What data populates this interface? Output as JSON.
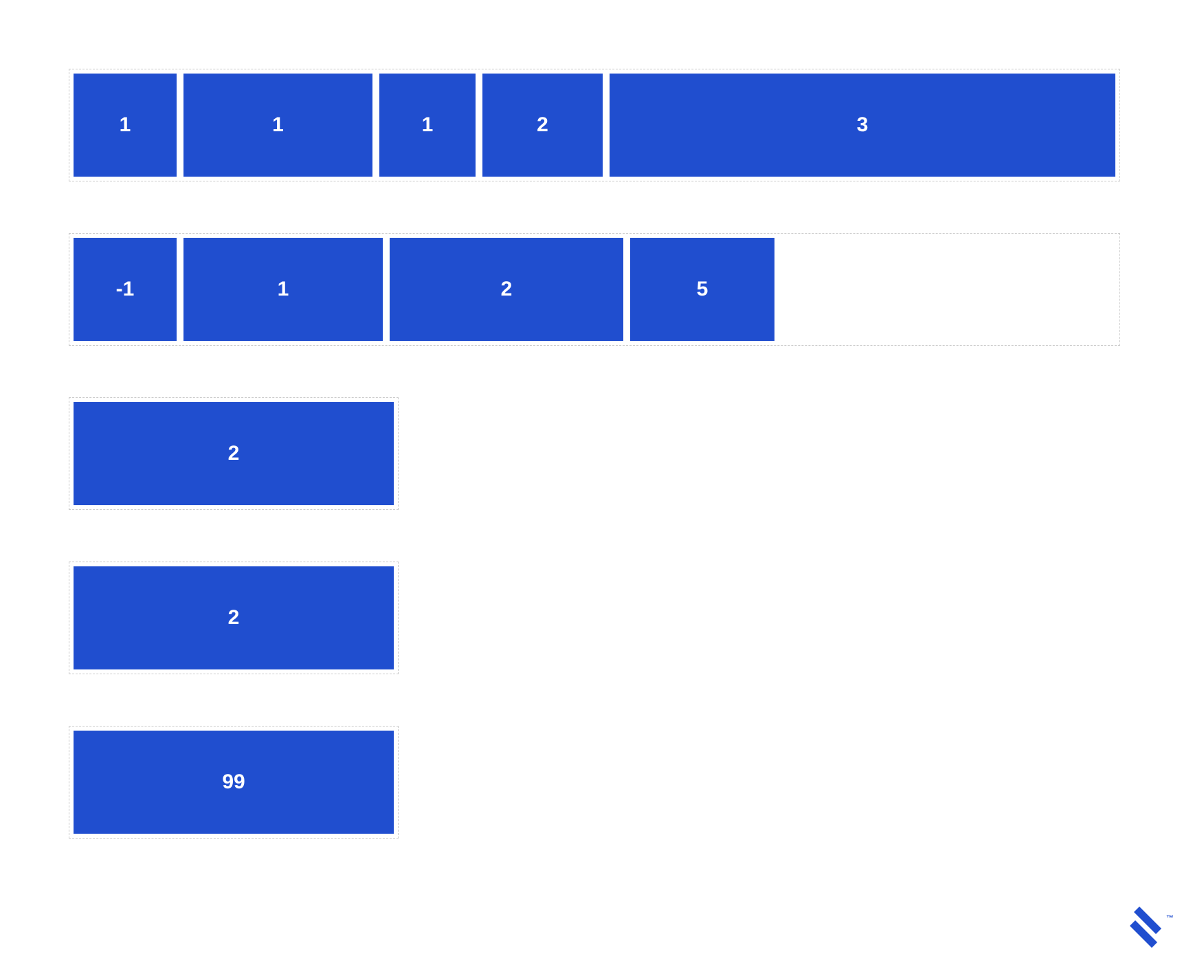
{
  "colors": {
    "box": "#204ecf",
    "text": "#ffffff",
    "border": "#c9c9c9"
  },
  "rows": [
    {
      "full_width": true,
      "items": [
        "1",
        "1",
        "1",
        "2",
        "3"
      ]
    },
    {
      "full_width": true,
      "items": [
        "-1",
        "1",
        "2",
        "5"
      ]
    },
    {
      "full_width": false,
      "items": [
        "2"
      ]
    },
    {
      "full_width": false,
      "items": [
        "2"
      ]
    },
    {
      "full_width": false,
      "items": [
        "99"
      ]
    }
  ],
  "logo": {
    "name": "toptal-logo",
    "tm": "™"
  }
}
